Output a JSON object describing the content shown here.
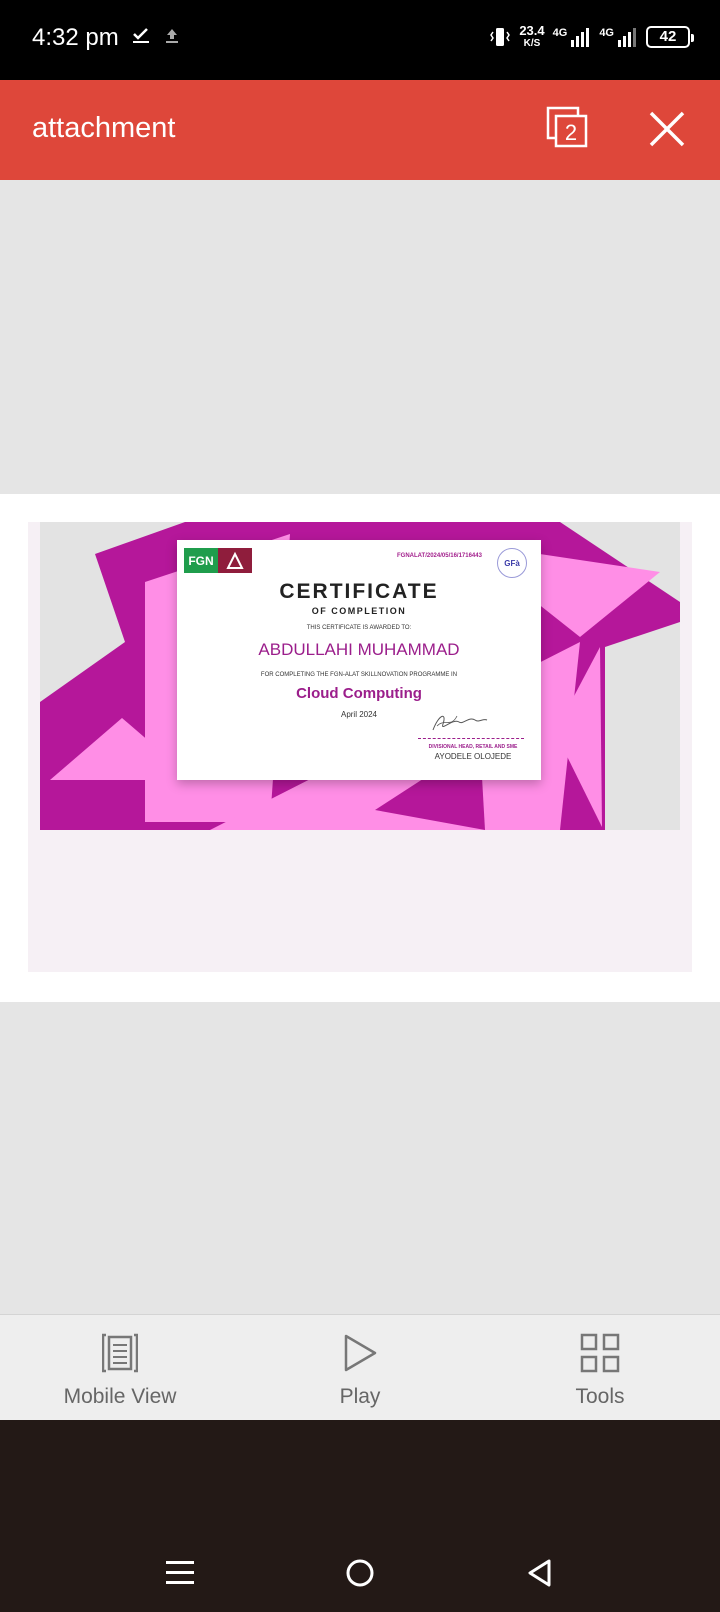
{
  "status_bar": {
    "time": "4:32 pm",
    "net_speed_value": "23.4",
    "net_speed_unit": "K/S",
    "sim1_tech": "4G",
    "sim2_tech": "4G",
    "battery": "42"
  },
  "app_bar": {
    "title": "attachment",
    "page_count": "2"
  },
  "certificate": {
    "logo_text": "FGN",
    "reference": "FGNALAT/2024/05/16/1716443",
    "badge_text": "GFà",
    "title": "CERTIFICATE",
    "subtitle": "OF COMPLETION",
    "awarded_text": "THIS CERTIFICATE IS AWARDED TO:",
    "recipient": "ABDULLAHI MUHAMMAD",
    "for_text": "FOR COMPLETING THE FGN-ALAT SKILLNOVATION PROGRAMME IN",
    "course": "Cloud Computing",
    "date": "April 2024",
    "signer_role": "DIVISIONAL HEAD, RETAIL AND SME",
    "signer_name": "AYODELE OLOJEDE",
    "colors": {
      "magenta": "#b5179a",
      "pink": "#ff8ee6",
      "grey": "#e3e3e3"
    }
  },
  "toolbar": {
    "items": [
      {
        "label": "Mobile View",
        "icon": "mobile-view-icon"
      },
      {
        "label": "Play",
        "icon": "play-icon"
      },
      {
        "label": "Tools",
        "icon": "tools-grid-icon"
      }
    ]
  },
  "nav_bar": {
    "buttons": [
      "menu-icon",
      "home-icon",
      "back-icon"
    ]
  },
  "colors": {
    "app_bar": "#de473a",
    "status_bar": "#000000",
    "nav_bar": "#231916",
    "toolbar": "#eeeeee"
  }
}
